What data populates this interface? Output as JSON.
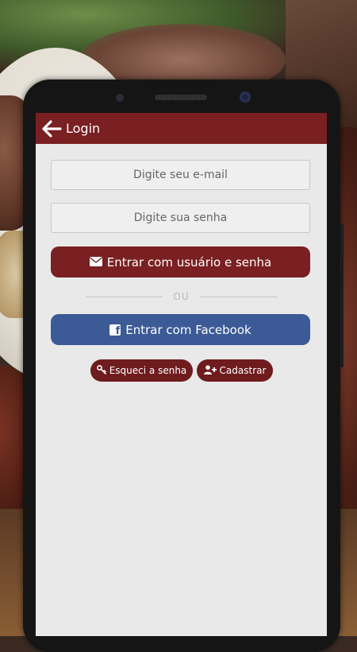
{
  "appbar": {
    "title": "Login",
    "back_icon": "arrow-left-icon"
  },
  "form": {
    "email_placeholder": "Digite seu e-mail",
    "password_placeholder": "Digite sua senha",
    "email_value": "",
    "password_value": ""
  },
  "buttons": {
    "login_label": "Entrar com usuário e senha",
    "login_icon": "envelope-icon",
    "separator": "OU",
    "facebook_label": "Entrar com Facebook",
    "facebook_icon": "facebook-icon",
    "forgot_label": "Esqueci a senha",
    "forgot_icon": "key-icon",
    "register_label": "Cadastrar",
    "register_icon": "user-plus-icon"
  },
  "colors": {
    "primary": "#7a1f22",
    "facebook": "#3b5a96",
    "screen_bg": "#e9e9e9"
  }
}
